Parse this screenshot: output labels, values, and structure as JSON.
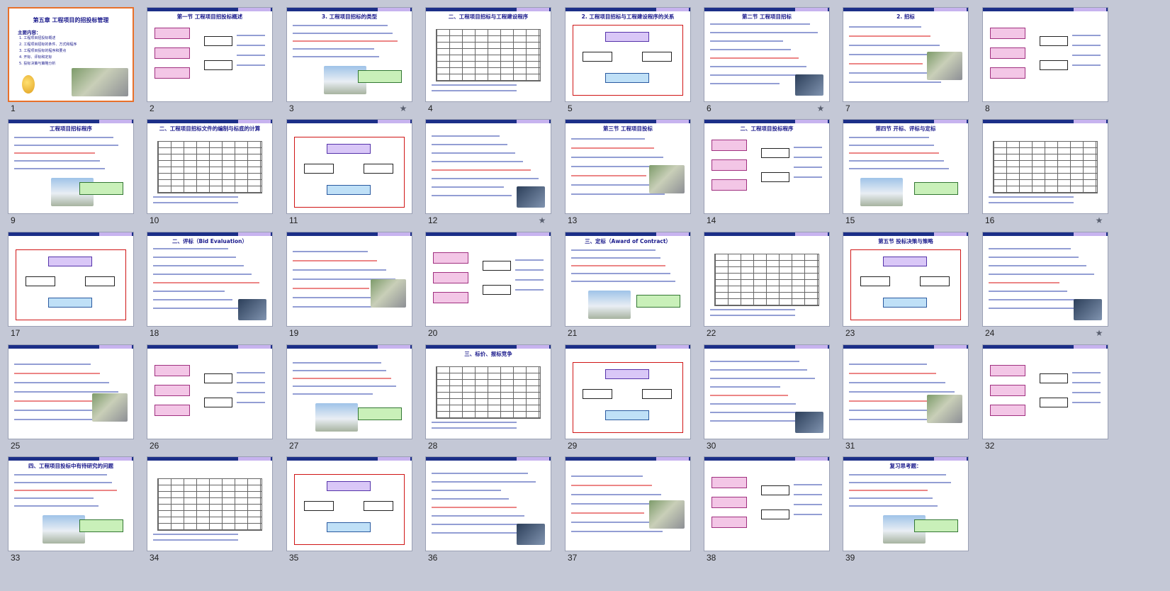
{
  "window": {
    "title": "第五章 工程项目的招投标管理"
  },
  "selected_slide": 1,
  "slides": [
    {
      "number": "1",
      "title": "第五章  工程项目的招投标管理",
      "animated": false
    },
    {
      "number": "2",
      "title": "第一节  工程项目招投标概述",
      "animated": false
    },
    {
      "number": "3",
      "title": "3. 工程项目招标的类型",
      "animated": true
    },
    {
      "number": "4",
      "title": "二、工程项目招标与工程建设程序",
      "animated": false
    },
    {
      "number": "5",
      "title": "2. 工程项目招标与工程建设程序的关系",
      "animated": false
    },
    {
      "number": "6",
      "title": "第二节  工程项目招标",
      "animated": true
    },
    {
      "number": "7",
      "title": "2. 招标",
      "animated": false
    },
    {
      "number": "8",
      "title": "",
      "animated": false
    },
    {
      "number": "9",
      "title": "工程项目招标程序",
      "animated": false
    },
    {
      "number": "10",
      "title": "二、工程项目招标文件的编制与标底的计算",
      "animated": false
    },
    {
      "number": "11",
      "title": "",
      "animated": false
    },
    {
      "number": "12",
      "title": "",
      "animated": true
    },
    {
      "number": "13",
      "title": "第三节  工程项目投标",
      "animated": false
    },
    {
      "number": "14",
      "title": "二、工程项目投标程序",
      "animated": false
    },
    {
      "number": "15",
      "title": "第四节  开标、评标与定标",
      "animated": false
    },
    {
      "number": "16",
      "title": "",
      "animated": true
    },
    {
      "number": "17",
      "title": "",
      "animated": false
    },
    {
      "number": "18",
      "title": "二、评标（Bid Evaluation）",
      "animated": false
    },
    {
      "number": "19",
      "title": "",
      "animated": false
    },
    {
      "number": "20",
      "title": "",
      "animated": false
    },
    {
      "number": "21",
      "title": "三、定标（Award of Contract）",
      "animated": false
    },
    {
      "number": "22",
      "title": "",
      "animated": false
    },
    {
      "number": "23",
      "title": "第五节  投标决策与策略",
      "animated": false
    },
    {
      "number": "24",
      "title": "",
      "animated": true
    },
    {
      "number": "25",
      "title": "",
      "animated": false
    },
    {
      "number": "26",
      "title": "",
      "animated": false
    },
    {
      "number": "27",
      "title": "",
      "animated": false
    },
    {
      "number": "28",
      "title": "三、标价、报标竞争",
      "animated": false
    },
    {
      "number": "29",
      "title": "",
      "animated": false
    },
    {
      "number": "30",
      "title": "",
      "animated": false
    },
    {
      "number": "31",
      "title": "",
      "animated": false
    },
    {
      "number": "32",
      "title": "",
      "animated": false
    },
    {
      "number": "33",
      "title": "四、工程项目投标中有待研究的问题",
      "animated": false
    },
    {
      "number": "34",
      "title": "",
      "animated": false
    },
    {
      "number": "35",
      "title": "",
      "animated": false
    },
    {
      "number": "36",
      "title": "",
      "animated": false
    },
    {
      "number": "37",
      "title": "",
      "animated": false
    },
    {
      "number": "38",
      "title": "",
      "animated": false
    },
    {
      "number": "39",
      "title": "复习思考题：",
      "animated": false
    }
  ],
  "cover": {
    "heading": "主要内容：",
    "items": [
      "1. 工程项目招投标概述",
      "2. 工程项目招标的条件、方式和程序",
      "3. 工程项目投标的程序和要点",
      "4. 开标、评标和定标",
      "5. 投标决策与策略分析"
    ]
  },
  "icons": {
    "animation": "animation-star-icon"
  },
  "colors": {
    "selected_border": "#e8702a",
    "header_bar": "#1c2f88",
    "title_text": "#1a1a8c"
  }
}
